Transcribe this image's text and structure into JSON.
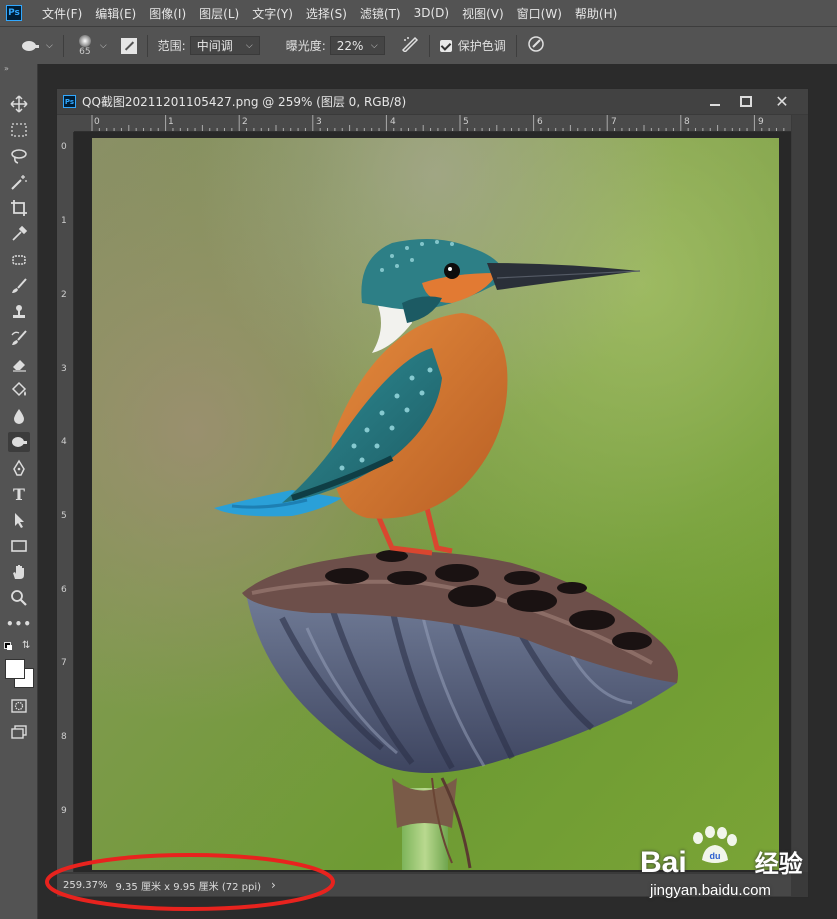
{
  "app": {
    "logo": "Ps"
  },
  "menu": [
    "文件(F)",
    "编辑(E)",
    "图像(I)",
    "图层(L)",
    "文字(Y)",
    "选择(S)",
    "滤镜(T)",
    "3D(D)",
    "视图(V)",
    "窗口(W)",
    "帮助(H)"
  ],
  "options": {
    "brush_size": "65",
    "range_label": "范围:",
    "range_value": "中间调",
    "exposure_label": "曝光度:",
    "exposure_value": "22%",
    "protect_tones_label": "保护色调",
    "protect_tones_checked": true
  },
  "tools": [
    "move-tool",
    "marquee-tool",
    "lasso-tool",
    "magic-wand-tool",
    "crop-tool",
    "eyedropper-tool",
    "healing-tool",
    "brush-tool",
    "stamp-tool",
    "history-brush-tool",
    "eraser-tool",
    "paint-bucket-tool",
    "blur-tool",
    "dodge-burn-tool",
    "pen-tool",
    "type-tool",
    "path-select-tool",
    "rectangle-tool",
    "hand-tool",
    "zoom-tool",
    "more-tools"
  ],
  "active_tool": "dodge-burn-tool",
  "document": {
    "title": "QQ截图20211201105427.png @ 259% (图层 0, RGB/8)",
    "ruler_top_ticks": [
      "0",
      "1",
      "2",
      "3",
      "4",
      "5",
      "6",
      "7",
      "8",
      "9"
    ],
    "ruler_left_ticks": [
      "0",
      "1",
      "2",
      "3",
      "4",
      "5",
      "6",
      "7",
      "8",
      "9"
    ],
    "status": {
      "zoom": "259.37%",
      "size": "9.35 厘米 x 9.95 厘米 (72 ppi)",
      "arrow": "›"
    }
  },
  "watermark": {
    "brand": "Bai",
    "brand_suffix": "经验",
    "url": "jingyan.baidu.com"
  },
  "colors": {
    "accent_ps": "#31a8ff",
    "annotation_red": "#e8231e"
  }
}
